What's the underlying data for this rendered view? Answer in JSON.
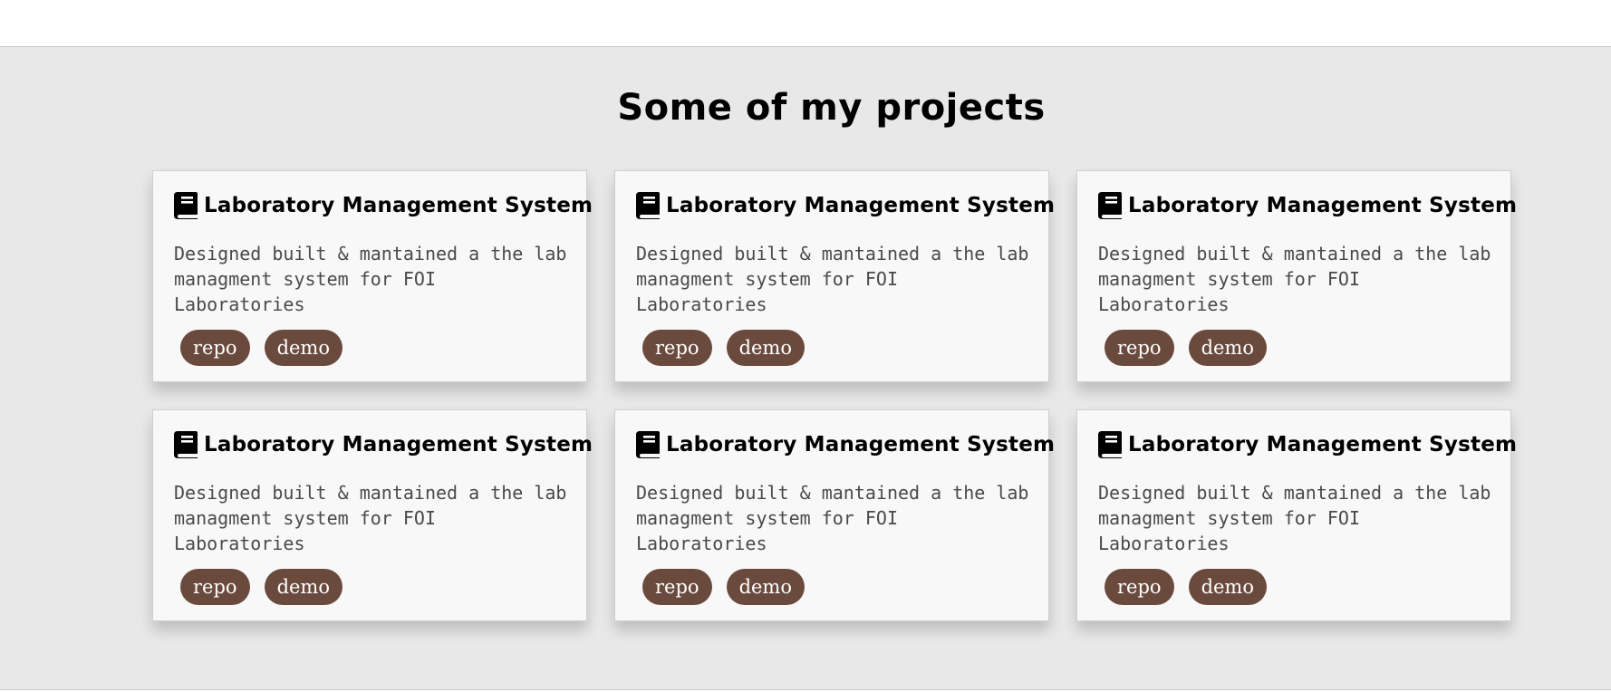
{
  "section": {
    "title": "Some of my projects"
  },
  "projects": [
    {
      "icon": "book-icon",
      "title": "Laboratory Management System",
      "description": "Designed built & mantained a the lab managment system for FOI Laboratories",
      "links": [
        "repo",
        "demo"
      ]
    },
    {
      "icon": "book-icon",
      "title": "Laboratory Management System",
      "description": "Designed built & mantained a the lab managment system for FOI Laboratories",
      "links": [
        "repo",
        "demo"
      ]
    },
    {
      "icon": "book-icon",
      "title": "Laboratory Management System",
      "description": "Designed built & mantained a the lab managment system for FOI Laboratories",
      "links": [
        "repo",
        "demo"
      ]
    },
    {
      "icon": "book-icon",
      "title": "Laboratory Management System",
      "description": "Designed built & mantained a the lab managment system for FOI Laboratories",
      "links": [
        "repo",
        "demo"
      ]
    },
    {
      "icon": "book-icon",
      "title": "Laboratory Management System",
      "description": "Designed built & mantained a the lab managment system for FOI Laboratories",
      "links": [
        "repo",
        "demo"
      ]
    },
    {
      "icon": "book-icon",
      "title": "Laboratory Management System",
      "description": "Designed built & mantained a the lab managment system for FOI Laboratories",
      "links": [
        "repo",
        "demo"
      ]
    }
  ],
  "colors": {
    "section_background": "#e8e8e8",
    "card_background": "#f8f8f8",
    "pill_background": "#6b4a3e",
    "pill_text": "#ffffff",
    "title_text": "#000000",
    "description_text": "#4a4a4a"
  }
}
